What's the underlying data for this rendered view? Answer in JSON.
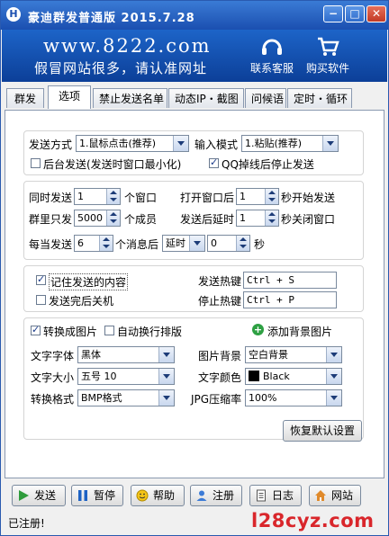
{
  "window": {
    "title": "豪迪群发普通版 2015.7.28",
    "controls": {
      "minimize": "−",
      "maximize": "□",
      "close": "✕"
    }
  },
  "banner": {
    "url": "www.8222.com",
    "slogan": "假冒网站很多，请认准网址",
    "support_label": "联系客服",
    "buy_label": "购买软件",
    "support_icon": "headset-icon",
    "buy_icon": "cart-icon"
  },
  "tabs": [
    {
      "label": "群发",
      "active": false
    },
    {
      "label": "选项",
      "active": true
    },
    {
      "label": "禁止发送名单",
      "active": false
    },
    {
      "label": "动态IP・截图",
      "active": false
    },
    {
      "label": "问候语",
      "active": false
    },
    {
      "label": "定时・循环",
      "active": false
    }
  ],
  "send": {
    "method_label": "发送方式",
    "method_value": "1.鼠标点击(推荐)",
    "input_label": "输入模式",
    "input_value": "1.粘贴(推荐)",
    "background_label": "后台发送(发送时窗口最小化)",
    "background_checked": false,
    "qq_stop_label": "QQ掉线后停止发送",
    "qq_stop_checked": true
  },
  "timing": {
    "simul_label": "同时发送",
    "simul_value": "1",
    "simul_unit": "个窗口",
    "open_label": "打开窗口后",
    "open_value": "1",
    "open_unit": "秒开始发送",
    "members_label": "群里只发",
    "members_value": "5000",
    "members_unit": "个成员",
    "close_label": "发送后延时",
    "close_value": "1",
    "close_unit": "秒关闭窗口",
    "every_label": "每当发送",
    "every_value": "6",
    "every_unit": "个消息后",
    "delay_mode": "延时",
    "delay_value": "0",
    "delay_unit": "秒"
  },
  "hotkeys": {
    "remember_label": "记住发送的内容",
    "remember_checked": true,
    "shutdown_label": "发送完后关机",
    "shutdown_checked": false,
    "send_hotkey_label": "发送热键",
    "send_hotkey_value": "Ctrl + S",
    "stop_hotkey_label": "停止热键",
    "stop_hotkey_value": "Ctrl + P"
  },
  "image": {
    "convert_label": "转换成图片",
    "convert_checked": true,
    "autowrap_label": "自动换行排版",
    "autowrap_checked": false,
    "add_bg_label": "添加背景图片",
    "font_label": "文字字体",
    "font_value": "黑体",
    "bg_label": "图片背景",
    "bg_value": "空白背景",
    "size_label": "文字大小",
    "size_value": "五号 10",
    "color_label": "文字颜色",
    "color_value": "Black",
    "format_label": "转换格式",
    "format_value": "BMP格式",
    "jpg_label": "JPG压缩率",
    "jpg_value": "100%"
  },
  "restore_defaults_label": "恢复默认设置",
  "toolbar": {
    "send": "发送",
    "pause": "暂停",
    "help": "帮助",
    "register": "注册",
    "log": "日志",
    "website": "网站"
  },
  "status": "已注册!",
  "watermark": "l28cyz.com",
  "colors": {
    "title_blue": "#1b4fb0",
    "banner_blue": "#0c3f98",
    "watermark_red": "#d9262b"
  }
}
